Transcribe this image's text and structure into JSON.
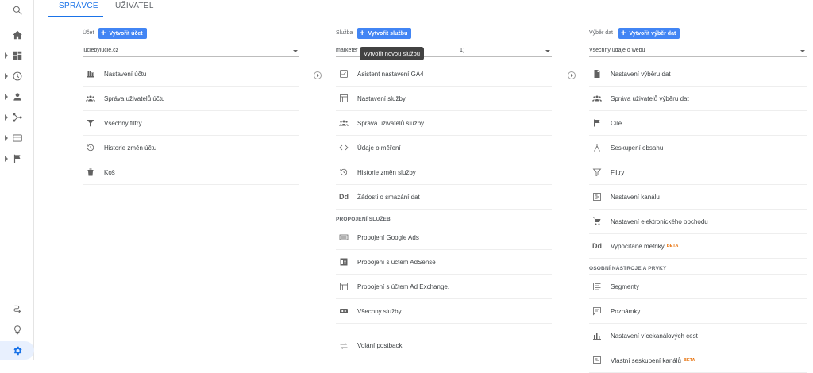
{
  "tabs": [
    {
      "label": "SPRÁVCE"
    },
    {
      "label": "UŽIVATEL"
    }
  ],
  "account": {
    "label": "Účet",
    "create_label": "Vytvořit účet",
    "selected": "luciebylucie.cz",
    "items": [
      {
        "label": "Nastavení účtu",
        "icon": "building-icon"
      },
      {
        "label": "Správa uživatelů účtu",
        "icon": "people-icon"
      },
      {
        "label": "Všechny filtry",
        "icon": "filter-icon"
      },
      {
        "label": "Historie změn účtu",
        "icon": "history-icon"
      },
      {
        "label": "Koš",
        "icon": "trash-icon"
      }
    ]
  },
  "property": {
    "label": "Služba",
    "create_label": "Vytvořit službu",
    "selected": "marketer",
    "selected_tail": "1)",
    "tooltip": "Vytvořit novou službu",
    "items": [
      {
        "label": "Asistent nastavení GA4",
        "icon": "checkbox-icon"
      },
      {
        "label": "Nastavení služby",
        "icon": "window-icon"
      },
      {
        "label": "Správa uživatelů služby",
        "icon": "people-icon"
      },
      {
        "label": "Údaje o měření",
        "icon": "code-icon"
      },
      {
        "label": "Historie změn služby",
        "icon": "history-icon"
      },
      {
        "label": "Žádosti o smazání dat",
        "icon": "dd-icon"
      }
    ],
    "section": "PROPOJENÍ SLUŽEB",
    "links": [
      {
        "label": "Propojení Google Ads",
        "icon": "ads-icon"
      },
      {
        "label": "Propojení s účtem AdSense",
        "icon": "adsense-icon"
      },
      {
        "label": "Propojení s účtem Ad Exchange.",
        "icon": "adx-icon"
      },
      {
        "label": "Všechny služby",
        "icon": "allproducts-icon"
      }
    ],
    "postback": {
      "label": "Volání postback",
      "icon": "postback-icon"
    }
  },
  "view": {
    "label": "Výběr dat",
    "create_label": "Vytvořit výběr dat",
    "selected": "Všechny údaje o webu",
    "items": [
      {
        "label": "Nastavení výběru dat",
        "icon": "document-icon"
      },
      {
        "label": "Správa uživatelů výběru dat",
        "icon": "people-icon"
      },
      {
        "label": "Cíle",
        "icon": "flag-icon"
      },
      {
        "label": "Seskupení obsahu",
        "icon": "grouping-icon"
      },
      {
        "label": "Filtry",
        "icon": "filter-icon"
      },
      {
        "label": "Nastavení kanálu",
        "icon": "channel-icon"
      },
      {
        "label": "Nastavení elektronického obchodu",
        "icon": "cart-icon"
      },
      {
        "label": "Vypočítané metriky",
        "icon": "dd-icon",
        "badge": "BETA"
      }
    ],
    "section": "OSOBNÍ NÁSTROJE A PRVKY",
    "tools": [
      {
        "label": "Segmenty",
        "icon": "segments-icon"
      },
      {
        "label": "Poznámky",
        "icon": "annotation-icon"
      },
      {
        "label": "Nastavení vícekanálových cest",
        "icon": "bars-icon"
      },
      {
        "label": "Vlastní seskupení kanálů",
        "icon": "custom-channel-icon",
        "badge": "BETA"
      }
    ]
  }
}
